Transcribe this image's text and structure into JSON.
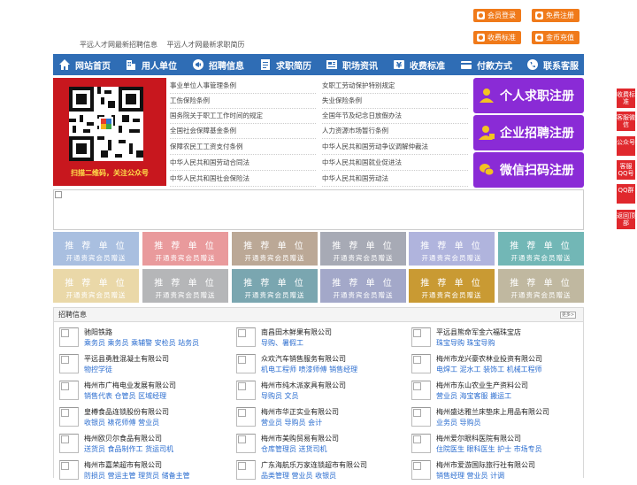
{
  "top": {
    "links": [
      "平远人才网最新招聘信息",
      "平远人才网最新求职简历"
    ],
    "buttons": [
      {
        "label": "会员登录"
      },
      {
        "label": "免费注册"
      },
      {
        "label": "收费标准"
      },
      {
        "label": "金币充值"
      }
    ]
  },
  "nav": [
    {
      "label": "网站首页",
      "icon": "home-icon"
    },
    {
      "label": "用人单位",
      "icon": "building-icon"
    },
    {
      "label": "招聘信息",
      "icon": "megaphone-icon"
    },
    {
      "label": "求职简历",
      "icon": "resume-icon"
    },
    {
      "label": "职场资讯",
      "icon": "news-icon"
    },
    {
      "label": "收费标准",
      "icon": "price-icon"
    },
    {
      "label": "付款方式",
      "icon": "card-icon"
    },
    {
      "label": "联系客服",
      "icon": "phone-icon"
    }
  ],
  "qr_caption": "扫描二维码，关注公众号",
  "laws_left": [
    "事业单位人事管理条例",
    "工伤保险条例",
    "国务院关于职工工作时间的规定",
    "全国社会保障基金条例",
    "保障农民工工资支付条例",
    "中华人民共和国劳动合同法",
    "中华人民共和国社会保险法"
  ],
  "laws_right": [
    "女职工劳动保护特别规定",
    "失业保险条例",
    "全国年节及纪念日放假办法",
    "人力资源市场暂行条例",
    "中华人民共和国劳动争议调解仲裁法",
    "中华人民共和国就业促进法",
    "中华人民共和国劳动法"
  ],
  "register": [
    "个人求职注册",
    "企业招聘注册",
    "微信扫码注册"
  ],
  "rec": {
    "title": "推 荐 单 位",
    "sub": "开通贵宾会员赠送",
    "colors": [
      "#a9bfe0",
      "#e99a9c",
      "#bba896",
      "#a7aab5",
      "#b0b4dd",
      "#72b7b6",
      "#ead8a8",
      "#b5b6b8",
      "#7aa6b0",
      "#a3a8c9",
      "#c99a33",
      "#c0b8a0"
    ]
  },
  "jobs_head": {
    "title": "招聘信息",
    "more": "更多>"
  },
  "jobs": [
    {
      "co": "驰阳铁路",
      "pos": "乘务员 乘务员 乘辅警 安检员 站务员"
    },
    {
      "co": "南昌田木鲜果有限公司",
      "pos": "导购、暑假工"
    },
    {
      "co": "平远县熊命军金六福珠宝店",
      "pos": "珠宝导购 珠宝导购"
    },
    {
      "co": "平远县勇胜混凝土有限公司",
      "pos": "物控学徒"
    },
    {
      "co": "众欢汽车销售服务有限公司",
      "pos": "机电工程师 喷漆师傅 销售经理"
    },
    {
      "co": "梅州市龙兴豪农林业投资有限公司",
      "pos": "电焊工 泥水工 装饰工 机械工程师"
    },
    {
      "co": "梅州市广梅电业发展有限公司",
      "pos": "销售代表 仓管员 区域经理"
    },
    {
      "co": "梅州市纯木派家具有限公司",
      "pos": "导购员 文员"
    },
    {
      "co": "梅州市东山农业生产资料公司",
      "pos": "营业员 海宝客服 搬运工"
    },
    {
      "co": "皇樽食品连锁股份有限公司",
      "pos": "收银员 裱花师傅 营业员"
    },
    {
      "co": "梅州市华正实业有限公司",
      "pos": "营业员 导购员 会计"
    },
    {
      "co": "梅州盛达雅兰床垫床上用品有限公司",
      "pos": "业务员 导购员"
    },
    {
      "co": "梅州欧贝尔食品有限公司",
      "pos": "送货员 食品制作工 货运司机"
    },
    {
      "co": "梅州市美购贸易有限公司",
      "pos": "仓库管理员 送货司机"
    },
    {
      "co": "梅州爱尔眼科医院有限公司",
      "pos": "住院医生 眼科医生 护士 市场专员"
    },
    {
      "co": "梅州市嘉荣超市有限公司",
      "pos": "防损员 营运主管 理货员 储备主管"
    },
    {
      "co": "广东海航乐万家连锁超市有限公司",
      "pos": "品类管理 营业员 收银员"
    },
    {
      "co": "梅州市爱游国际旅行社有限公司",
      "pos": "销售经理 营业员 计调"
    }
  ],
  "side": [
    "收费标准",
    "客服微信",
    "公众号",
    "客服QQ号",
    "QQ群",
    "返回顶部"
  ]
}
